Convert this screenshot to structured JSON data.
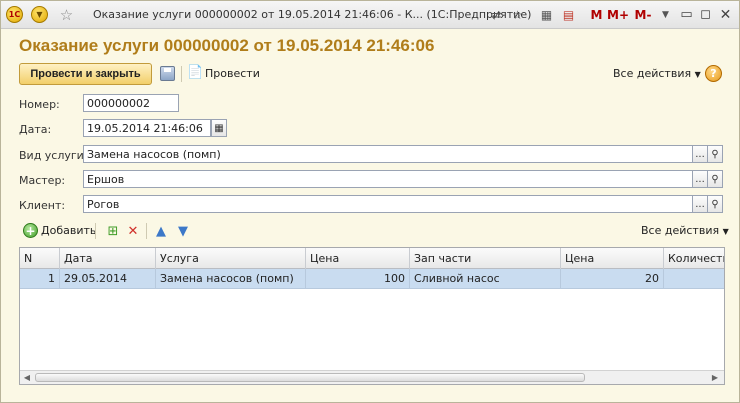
{
  "window": {
    "title": "Оказание услуги 000000002 от 19.05.2014 21:46:06 - К... (1С:Предприятие)",
    "logo_text": "1С"
  },
  "header": {
    "doc_title": "Оказание услуги 000000002 от 19.05.2014 21:46:06",
    "post_close_label": "Провести и закрыть",
    "post_label": "Провести",
    "all_actions_label": "Все действия",
    "help_label": "?"
  },
  "titlebar_tools": {
    "m": "M",
    "m_plus": "M+",
    "m_minus": "M-"
  },
  "form": {
    "number_label": "Номер:",
    "number_value": "000000002",
    "date_label": "Дата:",
    "date_value": "19.05.2014 21:46:06",
    "service_label": "Вид услуги:",
    "service_value": "Замена насосов (помп)",
    "master_label": "Мастер:",
    "master_value": "Ершов",
    "client_label": "Клиент:",
    "client_value": "Рогов",
    "select_button": "...",
    "search_button": "Q"
  },
  "table_toolbar": {
    "add_label": "Добавить",
    "all_actions_label": "Все действия"
  },
  "table": {
    "columns": [
      "N",
      "Дата",
      "Услуга",
      "Цена",
      "Зап части",
      "Цена",
      "Количество"
    ],
    "rows": [
      {
        "n": "1",
        "date": "29.05.2014",
        "service": "Замена насосов (помп)",
        "price": "100",
        "part": "Сливной насос",
        "part_price": "20",
        "qty": ""
      }
    ]
  }
}
